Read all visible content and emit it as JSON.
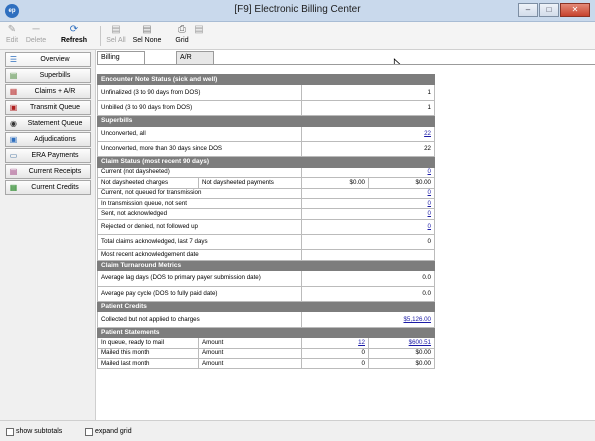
{
  "window": {
    "title": "[F9] Electronic Billing Center",
    "app_icon_text": "ep"
  },
  "toolbar": {
    "edit": "Edit",
    "delete": "Delete",
    "refresh": "Refresh",
    "sel_all": "Sel All",
    "sel_none": "Sel None",
    "grid": "Grid"
  },
  "sidebar": {
    "items": [
      {
        "label": "Overview",
        "icon": "overview-icon"
      },
      {
        "label": "Superbills",
        "icon": "superbills-icon"
      },
      {
        "label": "Claims + A/R",
        "icon": "claims-icon"
      },
      {
        "label": "Transmit Queue",
        "icon": "transmit-icon"
      },
      {
        "label": "Statement Queue",
        "icon": "statement-icon"
      },
      {
        "label": "Adjudications",
        "icon": "adjudications-icon"
      },
      {
        "label": "ERA Payments",
        "icon": "era-icon"
      },
      {
        "label": "Current Receipts",
        "icon": "receipts-icon"
      },
      {
        "label": "Current Credits",
        "icon": "credits-icon"
      }
    ]
  },
  "tabs": [
    {
      "label": "Billing Performance"
    },
    {
      "label": "A/R Summary"
    }
  ],
  "grid": {
    "sec1": "Encounter Note Status (sick and well)",
    "r1": {
      "label": "Unfinalized (3 to 90 days from DOS)",
      "value": "1"
    },
    "r2": {
      "label": "Unbilled (3 to 90 days from DOS)",
      "value": "1"
    },
    "sec2": "Superbills",
    "r3": {
      "label": "Unconverted, all",
      "value": "22"
    },
    "r4": {
      "label": "Unconverted, more than 30 days since DOS",
      "value": "22"
    },
    "sec3": "Claim Status (most recent 90 days)",
    "r5": {
      "label": "Current (not daysheeted)",
      "value": "0"
    },
    "r6": {
      "label": "Not daysheeted charges",
      "sub": "Not daysheeted payments",
      "v1": "$0.00",
      "v2": "$0.00"
    },
    "r7": {
      "label": "Current, not queued for transmission",
      "value": "0"
    },
    "r8": {
      "label": "In transmission queue, not sent",
      "value": "0"
    },
    "r9": {
      "label": "Sent, not acknowledged",
      "value": "0"
    },
    "r10": {
      "label": "Rejected or denied, not followed up",
      "value": "0"
    },
    "r11": {
      "label": "Total claims acknowledged, last 7 days",
      "value": "0"
    },
    "r12": {
      "label": "Most recent acknowledgement date",
      "value": ""
    },
    "sec4": "Claim Turnaround Metrics",
    "r13": {
      "label": "Average lag days (DOS to primary payer submission date)",
      "value": "0.0"
    },
    "r14": {
      "label": "Average pay cycle (DOS to fully paid date)",
      "value": "0.0"
    },
    "sec5": "Patient Credits",
    "r15": {
      "label": "Collected but not applied to charges",
      "value": "$5,126.00"
    },
    "sec6": "Patient Statements",
    "r16": {
      "label": "In queue, ready to mail",
      "sub": "Amount",
      "v1": "12",
      "v2": "$600.51"
    },
    "r17": {
      "label": "Mailed this month",
      "sub": "Amount",
      "v1": "0",
      "v2": "$0.00"
    },
    "r18": {
      "label": "Mailed last month",
      "sub": "Amount",
      "v1": "0",
      "v2": "$0.00"
    }
  },
  "footer": {
    "show_subtotals": "show subtotals",
    "expand_grid": "expand grid"
  }
}
